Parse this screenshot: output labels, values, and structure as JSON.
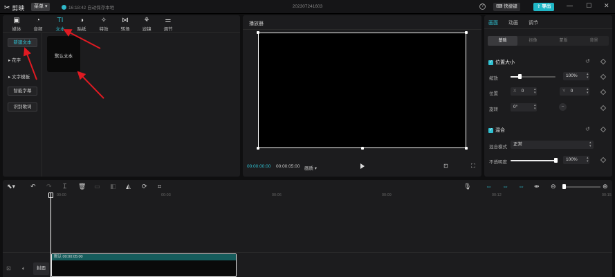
{
  "titlebar": {
    "app_name": "剪映",
    "menu_label": "菜单",
    "autosave": "16:18:42 自动保存本地",
    "project_title": "202307241603",
    "help": "?",
    "shortcut_label": "快捷键",
    "export_label": "导出"
  },
  "media_tabs": [
    {
      "label": "媒体",
      "icon": "media-icon"
    },
    {
      "label": "音频",
      "icon": "audio-icon"
    },
    {
      "label": "文本",
      "icon": "text-icon",
      "active": true
    },
    {
      "label": "贴纸",
      "icon": "sticker-icon"
    },
    {
      "label": "特效",
      "icon": "effects-icon"
    },
    {
      "label": "转场",
      "icon": "transition-icon"
    },
    {
      "label": "滤镜",
      "icon": "filter-icon"
    },
    {
      "label": "调节",
      "icon": "adjust-icon"
    }
  ],
  "text_tab_glyph": "TI",
  "categories": {
    "new_text": "新建文本",
    "fancy": "花字",
    "template": "文字模板",
    "auto_caption": "智能字幕",
    "lyrics": "识别歌词"
  },
  "asset_card": "默认文本",
  "player": {
    "title": "播放器",
    "current_time": "00:00:00:00",
    "total_time": "00:00:05:00",
    "quality": "画质"
  },
  "inspector": {
    "tabs": [
      "画面",
      "动画",
      "调节"
    ],
    "subtabs": [
      "基础",
      "抠像",
      "蒙版",
      "背景"
    ],
    "position_size": "位置大小",
    "scale_label": "缩放",
    "scale_value": "100%",
    "scale_fraction": 1.0,
    "position_label": "位置",
    "x_label": "X",
    "x_value": "0",
    "y_label": "Y",
    "y_value": "0",
    "rotate_label": "旋转",
    "rotate_value": "0°",
    "blend": "混合",
    "blend_mode_label": "混合模式",
    "blend_mode_value": "正常",
    "opacity_label": "不透明度",
    "opacity_value": "100%",
    "opacity_fraction": 1.0
  },
  "timeline": {
    "ticks": [
      "00:00",
      "00:03",
      "00:06",
      "00:09",
      "00:12",
      "00:15"
    ],
    "clip_label": "默认  00:00:05:00",
    "cover_label": "封面"
  },
  "colors": {
    "accent": "#2fc1d2",
    "annotation_arrow": "#e01a22"
  }
}
